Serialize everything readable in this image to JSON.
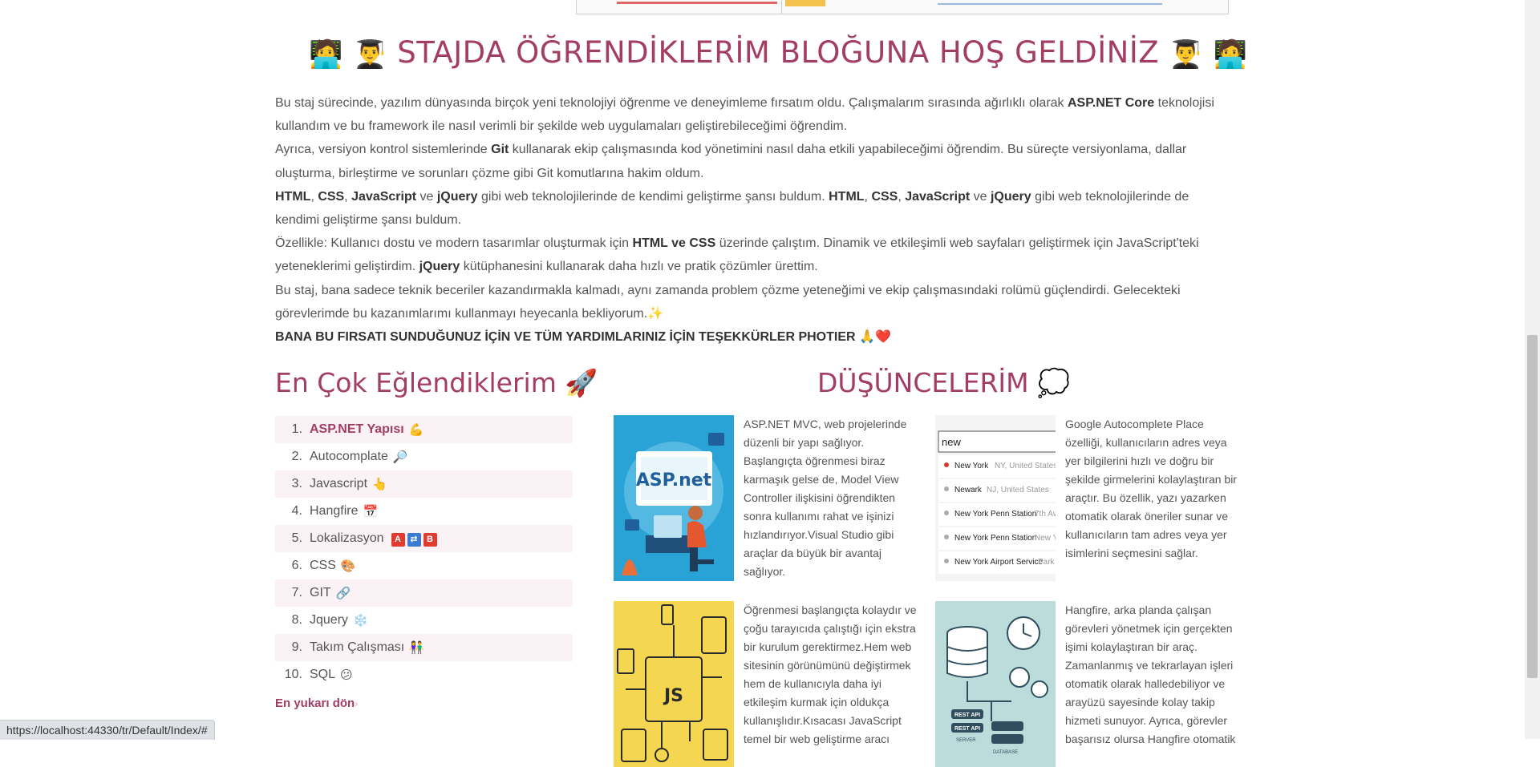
{
  "page": {
    "welcome_title": "STAJDA ÖĞRENDİKLERİM BLOĞUNA HOŞ GELDİNİZ",
    "welcome_emojis_left": [
      "🧑‍💻",
      "👨‍🎓"
    ],
    "welcome_emojis_right": [
      "👨‍🎓",
      "🧑‍💻"
    ]
  },
  "intro": {
    "p1_a": "Bu staj sürecinde, yazılım dünyasında birçok yeni teknolojiyi öğrenme ve deneyimleme fırsatım oldu. Çalışmalarım sırasında ağırlıklı olarak ",
    "p1_b": "ASP.NET Core",
    "p1_c": " teknolojisi kullandım ve bu framework ile nasıl verimli bir şekilde web uygulamaları geliştirebileceğimi öğrendim.",
    "p2_a": "Ayrıca, versiyon kontrol sistemlerinde ",
    "p2_b": "Git",
    "p2_c": " kullanarak ekip çalışmasında kod yönetimini nasıl daha etkili yapabileceğimi öğrendim. Bu süreçte versiyonlama, dallar oluşturma, birleştirme ve sorunları çözme gibi Git komutlarına hakim oldum.",
    "p3_html1": "HTML",
    "p3_css1": "CSS",
    "p3_js1": "JavaScript",
    "p3_jq1": "jQuery",
    "p3_mid": " gibi web teknolojilerinde de kendimi geliştirme şansı buldum. ",
    "p3_end": " gibi web teknolojilerinde de kendimi geliştirme şansı buldum.",
    "comma": ", ",
    "and": " ve ",
    "p4_a": "Özellikle: Kullanıcı dostu ve modern tasarımlar oluşturmak için ",
    "p4_b": "HTML ve CSS",
    "p4_c": " üzerinde çalıştım. Dinamik ve etkileşimli web sayfaları geliştirmek için JavaScript'teki yeteneklerimi geliştirdim. ",
    "p4_d": "jQuery",
    "p4_e": " kütüphanesini kullanarak daha hızlı ve pratik çözümler ürettim.",
    "p5": "Bu staj, bana sadece teknik beceriler kazandırmakla kalmadı, aynı zamanda problem çözme yeteneğimi ve ekip çalışmasındaki rolümü güçlendirdi. Gelecekteki görevlerimde bu kazanımlarımı kullanmayı heyecanla bekliyorum.",
    "p5_emoji": "✨",
    "thanks": "BANA BU FIRSATI SUNDUĞUNUZ İÇİN VE TÜM YARDIMLARINIZ İÇİN TEŞEKKÜRLER PHOTIER",
    "thanks_emoji": "🙏❤️"
  },
  "favorites": {
    "title": "En Çok Eğlendiklerim",
    "title_emoji": "🚀",
    "items": [
      {
        "num": "1.",
        "label": "ASP.NET Yapısı",
        "icon": "💪"
      },
      {
        "num": "2.",
        "label": "Autocomplate",
        "icon": "🔎"
      },
      {
        "num": "3.",
        "label": "Javascript",
        "icon": "👆"
      },
      {
        "num": "4.",
        "label": "Hangfire",
        "icon": "📅"
      },
      {
        "num": "5.",
        "label": "Lokalizasyon",
        "icon": ""
      },
      {
        "num": "6.",
        "label": "CSS",
        "icon": "🎨"
      },
      {
        "num": "7.",
        "label": "GIT",
        "icon": "🔗"
      },
      {
        "num": "8.",
        "label": "Jquery",
        "icon": "❄️"
      },
      {
        "num": "9.",
        "label": "Takım Çalışması",
        "icon": "👫"
      },
      {
        "num": "10.",
        "label": "SQL",
        "icon": "😕"
      }
    ],
    "loc_badges": [
      "A",
      "⇄",
      "B"
    ],
    "back_to_top": "En yukarı dön",
    "back_chevron": "›"
  },
  "thoughts": {
    "title": "DÜŞÜNCELERİM",
    "title_emoji": "💭",
    "cards": [
      {
        "text": "ASP.NET MVC, web projelerinde düzenli bir yapı sağlıyor. Başlangıçta öğrenmesi biraz karmaşık gelse de, Model View Controller ilişkisini öğrendikten sonra kullanımı rahat ve işinizi hızlandırıyor.Visual Studio gibi araçlar da büyük bir avantaj sağlıyor.",
        "image_label": "ASP.net"
      },
      {
        "text": "Google Autocomplete Place özelliği, kullanıcıların adres veya yer bilgilerini hızlı ve doğru bir şekilde girmelerini kolaylaştıran bir araçtır. Bu özellik, yazı yazarken otomatik olarak öneriler sunar ve kullanıcıların tam adres veya yer isimlerini seçmesini sağlar.",
        "image_label": "new"
      },
      {
        "text": "Öğrenmesi başlangıçta kolaydır ve çoğu tarayıcıda çalıştığı için ekstra bir kurulum gerektirmez.Hem web sitesinin görünümünü değiştirmek hem de kullanıcıyla daha iyi etkileşim kurmak için oldukça kullanışlıdır.Kısacası JavaScript temel bir web geliştirme aracı",
        "image_label": "JS"
      },
      {
        "text": "Hangfire, arka planda çalışan görevleri yönetmek için gerçekten işimi kolaylaştıran bir araç. Zamanlanmış ve tekrarlayan işleri otomatik olarak halledebiliyor ve arayüzü sayesinde kolay takip hizmeti sunuyor. Ayrıca, görevler başarısız olursa Hangfire otomatik",
        "image_label": "REST API"
      }
    ],
    "autocomplete_suggestions": [
      {
        "main": "New York",
        "sub": "NY, United States"
      },
      {
        "main": "Newark",
        "sub": "NJ, United States"
      },
      {
        "main": "New York Penn Station",
        "sub": "7th Av"
      },
      {
        "main": "New York Penn Station",
        "sub": "New Y"
      },
      {
        "main": "New York Airport Service",
        "sub": "Park"
      }
    ],
    "hangfire_labels": [
      "REST API",
      "REST API",
      "SERVER",
      "DATABASE"
    ]
  },
  "statusbar": {
    "url": "https://localhost:44330/tr/Default/Index/#"
  },
  "colors": {
    "accent": "#a33d64",
    "text": "#555555",
    "list_stripe": "#faf2f4"
  }
}
